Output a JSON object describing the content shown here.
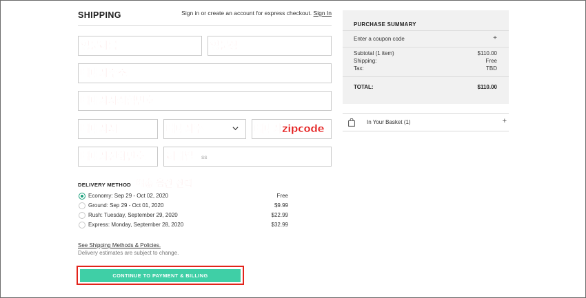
{
  "header": {
    "title": "SHIPPING",
    "signin_text": "Sign in or create an account for express checkout.",
    "signin_link": "Sign In"
  },
  "form": {
    "first_name": "영문이름",
    "last_name": "영문성",
    "address": "배대지주소",
    "address2": "배대지사서함번호",
    "city": "배대지시",
    "state": "배대지주",
    "zip": "배대지zipcode",
    "phone": "배대지전화번호",
    "email": "이메일",
    "email_placeholder_tail": "ss"
  },
  "delivery": {
    "title": "DELIVERY METHOD",
    "note": "배송 옵션 선택",
    "options": [
      {
        "label": "Economy: Sep 29 - Oct 02, 2020",
        "price": "Free",
        "selected": true
      },
      {
        "label": "Ground: Sep 29 - Oct 01, 2020",
        "price": "$9.99",
        "selected": false
      },
      {
        "label": "Rush: Tuesday, September 29, 2020",
        "price": "$22.99",
        "selected": false
      },
      {
        "label": "Express: Monday, September 28, 2020",
        "price": "$32.99",
        "selected": false
      }
    ],
    "policy_link": "See Shipping Methods & Policies.",
    "policy_note": "Delivery estimates are subject to change."
  },
  "cta": {
    "label": "CONTINUE TO PAYMENT & BILLING"
  },
  "summary": {
    "title": "PURCHASE SUMMARY",
    "coupon_label": "Enter a coupon code",
    "coupon_plus": "+",
    "subtotal_label": "Subtotal (1 item)",
    "subtotal_value": "$110.00",
    "shipping_label": "Shipping:",
    "shipping_value": "Free",
    "tax_label": "Tax:",
    "tax_value": "TBD",
    "total_label": "TOTAL:",
    "total_value": "$110.00"
  },
  "basket": {
    "label": "In Your Basket (1)",
    "plus": "+"
  },
  "colors": {
    "accent": "#3fcfa6",
    "annotation": "#e41a1a",
    "radio": "#1aa07c"
  },
  "icons": {
    "basket": "shopping-bag-icon",
    "select": "chevron-down-icon"
  }
}
